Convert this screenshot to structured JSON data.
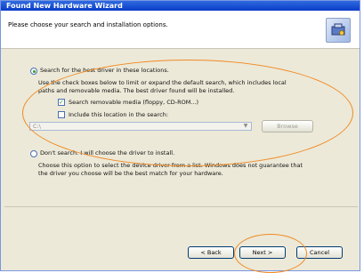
{
  "window": {
    "title": "Found New Hardware Wizard"
  },
  "header": {
    "instruction": "Please choose your search and installation options."
  },
  "options": {
    "search_best": {
      "label": "Search for the best driver in these locations.",
      "description_line1": "Use the check boxes below to limit or expand the default search, which includes local",
      "description_line2": "paths and removable media. The best driver found will be installed.",
      "checkbox_removable": "Search removable media (floppy, CD-ROM...)",
      "checkbox_location": "Include this location in the search:",
      "path_value": "C:\\",
      "browse_label": "Browse"
    },
    "dont_search": {
      "label": "Don't search. I will choose the driver to install.",
      "description_line1": "Choose this option to select the device driver from a list. Windows does not guarantee that",
      "description_line2": "the driver you choose will be the best match for your hardware."
    }
  },
  "footer": {
    "back_label": "< Back",
    "next_label": "Next >",
    "cancel_label": "Cancel"
  },
  "icons": {
    "wizard": "hardware-wizard-icon",
    "dropdown": "chevron-down-icon"
  },
  "colors": {
    "title_bar": "#0a3cc8",
    "highlight_ellipse": "#f08a24",
    "window_bg": "#ece9d8"
  }
}
